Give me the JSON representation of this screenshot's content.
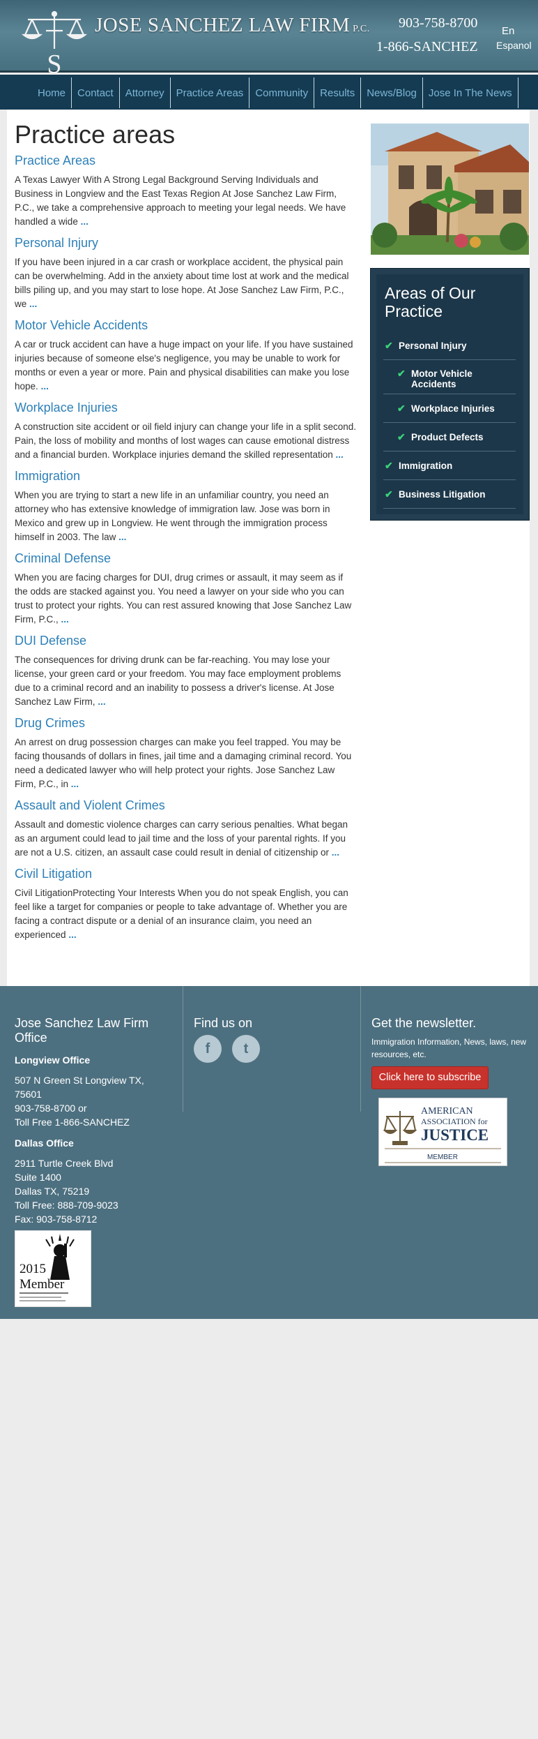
{
  "header": {
    "firm_name": "JOSE SANCHEZ LAW FIRM",
    "firm_suffix": "P.C.",
    "logo_letter": "S",
    "phone_primary": "903-758-8700",
    "phone_toll_free": "1-866-SANCHEZ",
    "lang_en": "En",
    "lang_es": "Espanol"
  },
  "nav": {
    "items": [
      "Home",
      "Contact",
      "Attorney",
      "Practice Areas",
      "Community",
      "Results",
      "News/Blog",
      "Jose In The News"
    ]
  },
  "main": {
    "page_title": "Practice areas",
    "more_label": "...",
    "sections": [
      {
        "title": "Practice Areas",
        "text": "A Texas Lawyer With A Strong Legal Background Serving Individuals and Business in Longview and the East Texas Region At Jose Sanchez Law Firm, P.C., we take a comprehensive approach to meeting your legal needs. We have handled a wide"
      },
      {
        "title": "Personal Injury",
        "text": "If you have been injured in a car crash or workplace accident, the physical pain can be overwhelming. Add in the anxiety about time lost at work and the medical bills piling up, and you may start to lose hope. At Jose Sanchez Law Firm, P.C., we"
      },
      {
        "title": "Motor Vehicle Accidents",
        "text": "A car or truck accident can have a huge impact on your life. If you have sustained injuries because of someone else's negligence, you may be unable to work for months or even a year or more. Pain and physical disabilities can make you lose hope."
      },
      {
        "title": "Workplace Injuries",
        "text": "A construction site accident or oil field injury can change your life in a split second. Pain, the loss of mobility and months of lost wages can cause emotional distress and a financial burden. Workplace injuries demand the skilled representation"
      },
      {
        "title": "Immigration",
        "text": "When you are trying to start a new life in an unfamiliar country, you need an attorney who has extensive knowledge of immigration law. Jose was born in Mexico and grew up in Longview. He went through the immigration process himself in 2003. The law"
      },
      {
        "title": "Criminal Defense",
        "text": "When you are facing charges for DUI, drug crimes or assault, it may seem as if the odds are stacked against you. You need a lawyer on your side who you can trust to protect your rights. You can rest assured knowing that Jose Sanchez Law Firm, P.C.,"
      },
      {
        "title": "DUI Defense",
        "text": "The consequences for driving drunk can be far-reaching. You may lose your license, your green card or your freedom. You may face employment problems due to a criminal record and an inability to possess a driver's license. At Jose Sanchez Law Firm,"
      },
      {
        "title": "Drug Crimes",
        "text": "An arrest on drug possession charges can make you feel trapped. You may be facing thousands of dollars in fines, jail time and a damaging criminal record. You need a dedicated lawyer who will help protect your rights. Jose Sanchez Law Firm, P.C., in"
      },
      {
        "title": "Assault and Violent Crimes",
        "text": "Assault and domestic violence charges can carry serious penalties. What began as an argument could lead to jail time and the loss of your parental rights. If you are not a U.S. citizen, an assault case could result in denial of citizenship or"
      },
      {
        "title": "Civil Litigation",
        "text": "Civil LitigationProtecting Your Interests When you do not speak English, you can feel like a target for companies or people to take advantage of. Whether you are facing a contract dispute or a denial of an insurance claim, you need an experienced"
      }
    ]
  },
  "sidebar": {
    "areas_title": "Areas of Our Practice",
    "areas": [
      {
        "label": "Personal Injury",
        "sub": false
      },
      {
        "label": "Motor Vehicle Accidents",
        "sub": true
      },
      {
        "label": "Workplace Injuries",
        "sub": true
      },
      {
        "label": "Product Defects",
        "sub": true
      },
      {
        "label": "Immigration",
        "sub": false
      },
      {
        "label": "Business Litigation",
        "sub": false
      }
    ]
  },
  "footer": {
    "office_title": "Jose Sanchez Law Firm Office",
    "longview_label": "Longview Office",
    "longview_address": [
      "507 N Green St Longview TX,",
      "75601",
      "903-758-8700 or",
      "Toll Free 1-866-SANCHEZ"
    ],
    "dallas_label": "Dallas Office",
    "dallas_address": [
      "2911 Turtle Creek Blvd",
      "Suite 1400",
      "Dallas TX, 75219",
      "Toll Free: 888-709-9023",
      "Fax: 903-758-8712"
    ],
    "find_us_title": "Find us on",
    "social": [
      {
        "icon": "facebook-icon",
        "glyph": "f"
      },
      {
        "icon": "twitter-icon",
        "glyph": "t"
      }
    ],
    "newsletter_title": "Get the newsletter.",
    "newsletter_text": "Immigration Information, News, laws, new resources, etc.",
    "subscribe_label": "Click here to subscribe",
    "aaj_badge": {
      "line1": "AMERICAN",
      "line2": "ASSOCIATION for",
      "line3": "JUSTICE",
      "line4": "MEMBER"
    },
    "member_badge": {
      "year": "2015",
      "label": "Member"
    }
  },
  "colors": {
    "link_blue": "#2d80b8",
    "nav_bg": "#143b52",
    "footer_bg": "#4d7080",
    "areas_bg": "#1c3749",
    "check_green": "#3bd27a",
    "subscribe_red": "#c8322c"
  }
}
